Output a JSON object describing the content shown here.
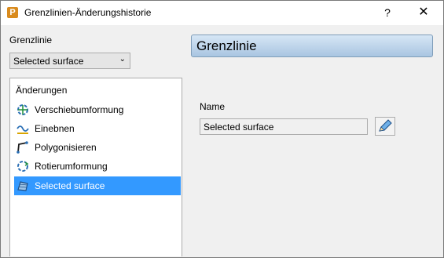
{
  "window": {
    "title": "Grenzlinien-Änderungshistorie",
    "app_icon_letter": "P",
    "help_label": "?",
    "close_label": "✕"
  },
  "left": {
    "section_label": "Grenzlinie",
    "dropdown": {
      "value": "Selected surface"
    },
    "tree": {
      "header": "Änderungen",
      "items": [
        {
          "label": "Verschiebumformung",
          "icon": "move-transform-icon"
        },
        {
          "label": "Einebnen",
          "icon": "flatten-icon"
        },
        {
          "label": "Polygonisieren",
          "icon": "polygonise-icon"
        },
        {
          "label": "Rotierumformung",
          "icon": "rotate-transform-icon"
        },
        {
          "label": "Selected surface",
          "icon": "surface-icon",
          "selected": true
        }
      ]
    }
  },
  "right": {
    "header_title": "Grenzlinie",
    "name_label": "Name",
    "name_value": "Selected surface"
  },
  "colors": {
    "selection": "#3399ff",
    "header_gradient_top": "#d6e6f5",
    "header_gradient_bottom": "#a9c5e1"
  }
}
